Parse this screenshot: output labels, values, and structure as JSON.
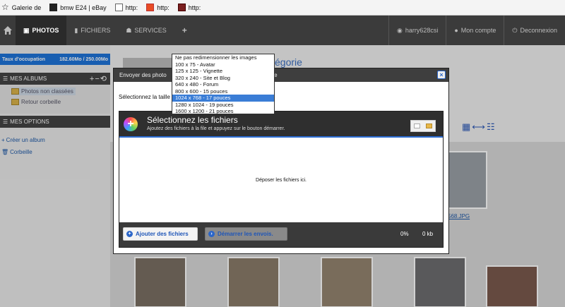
{
  "bookmarks": [
    {
      "label": "Galerie de",
      "icon": "star-icon"
    },
    {
      "label": "bmw E24 | eBay",
      "icon": "ebay-icon"
    },
    {
      "label": "http:",
      "icon": "page-icon"
    },
    {
      "label": "http:",
      "icon": "red-site-icon"
    },
    {
      "label": "http:",
      "icon": "dark-site-icon"
    }
  ],
  "nav": {
    "photos": "PHOTOS",
    "fichiers": "FICHIERS",
    "services": "SERVICES",
    "add": "+",
    "user": "harry628csi",
    "account": "Mon compte",
    "logout": "Deconnexion"
  },
  "sidebar": {
    "quota_label": "Taux d'occupation",
    "quota_value": "182.60Mo / 250.00Mo",
    "albums_head": "MES ALBUMS",
    "albums_tools": "+−⟲",
    "albums": [
      {
        "label": "Photos non classées",
        "selected": true
      },
      {
        "label": "Retour corbeille",
        "selected": false
      }
    ],
    "options_head": "MES OPTIONS",
    "create_album": "Créer un album",
    "trash": "Corbeille"
  },
  "main": {
    "category_title": "égorie",
    "photo_link": "568.JPG"
  },
  "modal": {
    "title": "Envoyer des photo",
    "title_tail": "rie",
    "size_label": "Sélectionnez la taille",
    "close": "×",
    "uploader": {
      "title": "Sélectionnez les fichiers",
      "subtitle": "Ajoutez des fichiers à la file et appuyez sur le bouton démarrer.",
      "drop_text": "Déposer les fichiers ici.",
      "add_button": "Ajouter des fichiers",
      "start_button": "Démarrer les envois.",
      "percent": "0%",
      "size": "0 kb"
    }
  },
  "size_options": [
    "Ne pas redimensionner les images",
    "100 x 75 - Avatar",
    "125 x 125 - Vignette",
    "320 x 240 - Site et Blog",
    "640 x 480 - Forum",
    "800 x 600 - 15 pouces",
    "1024 x 768 - 17 pouces",
    "1280 x 1024 - 19 pouces",
    "1600 x 1200 - 21 pouces"
  ],
  "selected_size_index": 6,
  "colors": {
    "accent": "#1e73d8",
    "nav_bg": "#3b3b3b",
    "highlight": "#3a7dd6"
  }
}
